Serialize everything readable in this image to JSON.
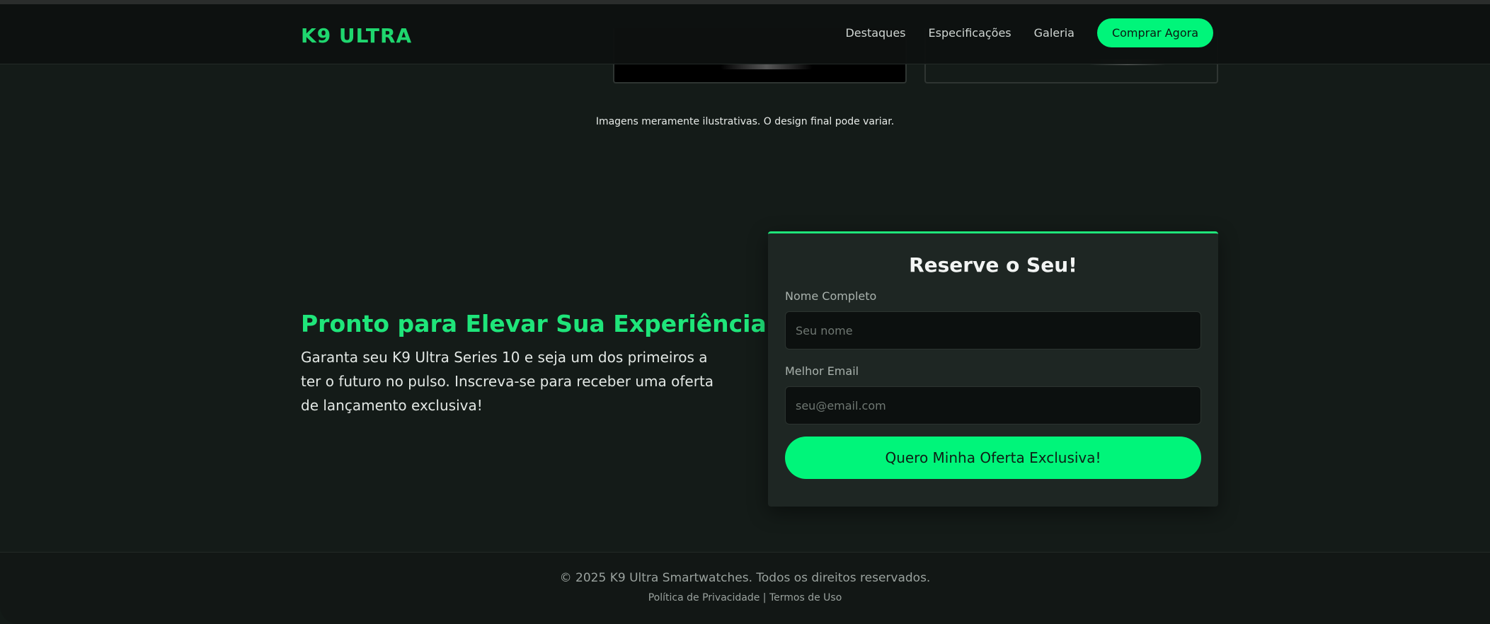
{
  "header": {
    "logo": "K9 ULTRA",
    "nav": [
      "Destaques",
      "Especificações",
      "Galeria"
    ],
    "cta": "Comprar Agora"
  },
  "gallery": {
    "note": "Imagens meramente ilustrativas. O design final pode variar."
  },
  "cta_section": {
    "title": "Pronto para Elevar Sua Experiência?",
    "text": "Garanta seu K9 Ultra Series 10 e seja um dos primeiros a ter o futuro no pulso. Inscreva-se para receber uma oferta de lançamento exclusiva!"
  },
  "form": {
    "title": "Reserve o Seu!",
    "name_label": "Nome Completo",
    "name_placeholder": "Seu nome",
    "email_label": "Melhor Email",
    "email_placeholder": "seu@email.com",
    "submit": "Quero Minha Oferta Exclusiva!"
  },
  "footer": {
    "copyright": "© 2025 K9 Ultra Smartwatches. Todos os direitos reservados.",
    "privacy": "Política de Privacidade",
    "separator": "|",
    "terms": "Termos de Uso"
  },
  "colors": {
    "accent": "#00f57a",
    "heading_green": "#1fe57a",
    "background": "#141b18",
    "card": "#1e2623"
  }
}
